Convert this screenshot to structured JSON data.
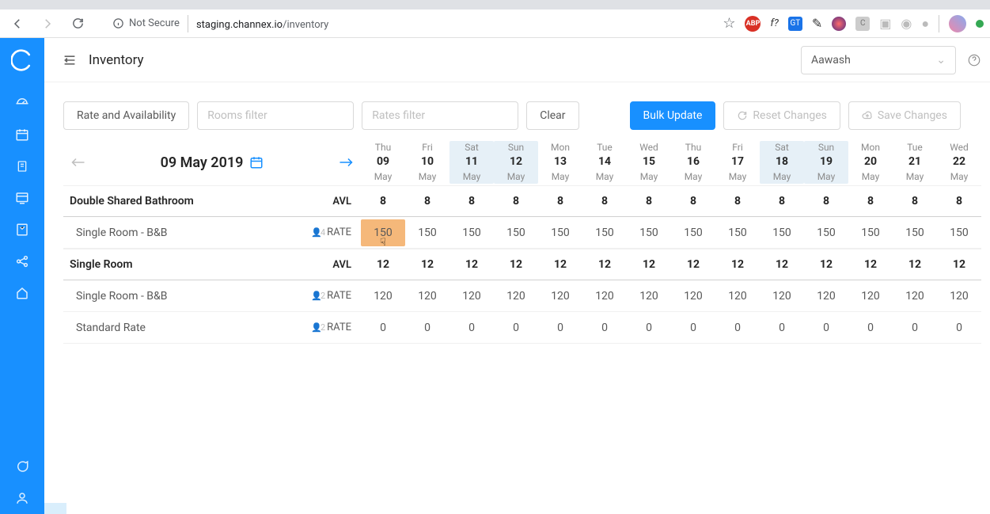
{
  "browser": {
    "not_secure": "Not Secure",
    "url_host": "staging.channex.io",
    "url_path": "/inventory"
  },
  "page": {
    "title": "Inventory"
  },
  "property": {
    "selected": "Aawash"
  },
  "toolbar": {
    "rate_availability": "Rate and Availability",
    "rooms_filter_ph": "Rooms filter",
    "rates_filter_ph": "Rates filter",
    "clear": "Clear",
    "bulk_update": "Bulk Update",
    "reset_changes": "Reset Changes",
    "save_changes": "Save Changes"
  },
  "date_nav": {
    "label": "09 May 2019"
  },
  "days": [
    {
      "dow": "Thu",
      "num": "09",
      "mon": "May",
      "weekend": false
    },
    {
      "dow": "Fri",
      "num": "10",
      "mon": "May",
      "weekend": false
    },
    {
      "dow": "Sat",
      "num": "11",
      "mon": "May",
      "weekend": true
    },
    {
      "dow": "Sun",
      "num": "12",
      "mon": "May",
      "weekend": true
    },
    {
      "dow": "Mon",
      "num": "13",
      "mon": "May",
      "weekend": false
    },
    {
      "dow": "Tue",
      "num": "14",
      "mon": "May",
      "weekend": false
    },
    {
      "dow": "Wed",
      "num": "15",
      "mon": "May",
      "weekend": false
    },
    {
      "dow": "Thu",
      "num": "16",
      "mon": "May",
      "weekend": false
    },
    {
      "dow": "Fri",
      "num": "17",
      "mon": "May",
      "weekend": false
    },
    {
      "dow": "Sat",
      "num": "18",
      "mon": "May",
      "weekend": true
    },
    {
      "dow": "Sun",
      "num": "19",
      "mon": "May",
      "weekend": true
    },
    {
      "dow": "Mon",
      "num": "20",
      "mon": "May",
      "weekend": false
    },
    {
      "dow": "Tue",
      "num": "21",
      "mon": "May",
      "weekend": false
    },
    {
      "dow": "Wed",
      "num": "22",
      "mon": "May",
      "weekend": false
    }
  ],
  "rows": [
    {
      "kind": "header",
      "label": "Double Shared Bathroom",
      "type": "AVL",
      "values": [
        "8",
        "8",
        "8",
        "8",
        "8",
        "8",
        "8",
        "8",
        "8",
        "8",
        "8",
        "8",
        "8",
        "8"
      ]
    },
    {
      "kind": "rate",
      "label": "Single Room - B&B",
      "occ": "4",
      "type": "RATE",
      "values": [
        "150",
        "150",
        "150",
        "150",
        "150",
        "150",
        "150",
        "150",
        "150",
        "150",
        "150",
        "150",
        "150",
        "150"
      ],
      "highlight": 0
    },
    {
      "kind": "header",
      "label": "Single Room",
      "type": "AVL",
      "values": [
        "12",
        "12",
        "12",
        "12",
        "12",
        "12",
        "12",
        "12",
        "12",
        "12",
        "12",
        "12",
        "12",
        "12"
      ]
    },
    {
      "kind": "rate",
      "label": "Single Room - B&B",
      "occ": "2",
      "type": "RATE",
      "values": [
        "120",
        "120",
        "120",
        "120",
        "120",
        "120",
        "120",
        "120",
        "120",
        "120",
        "120",
        "120",
        "120",
        "120"
      ]
    },
    {
      "kind": "rate",
      "label": "Standard Rate",
      "occ": "2",
      "type": "RATE",
      "values": [
        "0",
        "0",
        "0",
        "0",
        "0",
        "0",
        "0",
        "0",
        "0",
        "0",
        "0",
        "0",
        "0",
        "0"
      ]
    }
  ],
  "ext": {
    "abp": "ABP",
    "f": "f?",
    "gt": "GT",
    "c": "C"
  }
}
